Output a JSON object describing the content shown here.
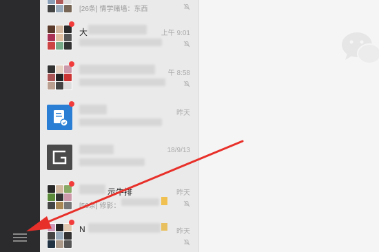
{
  "chats": [
    {
      "id": "row0",
      "name": "",
      "preview": "[26条] 情学赌墙：东西",
      "time": "",
      "unread": false,
      "avatar": "group",
      "muted": true
    },
    {
      "id": "row1",
      "name": "大",
      "preview": "",
      "time": "上午 9:01",
      "unread": true,
      "avatar": "group",
      "muted": true
    },
    {
      "id": "row2",
      "name": "",
      "preview": "",
      "time": "午 8:58",
      "unread": true,
      "avatar": "group",
      "muted": true
    },
    {
      "id": "row3",
      "name": "",
      "preview": "",
      "time": "昨天",
      "unread": true,
      "avatar": "doc",
      "muted": false
    },
    {
      "id": "row4",
      "name": "",
      "preview": "",
      "time": "18/9/13",
      "unread": false,
      "avatar": "g",
      "muted": false
    },
    {
      "id": "row5",
      "name": "示牛排",
      "preview": "[50条] 修影：",
      "time": "昨天",
      "unread": true,
      "avatar": "group",
      "muted": true
    },
    {
      "id": "row6",
      "name": "N",
      "preview": "",
      "time": "昨天",
      "unread": true,
      "avatar": "group",
      "muted": true
    }
  ],
  "colors": {
    "sidebar": "#2b2b2e",
    "list": "#eaeaea",
    "main": "#f5f5f5",
    "unread_dot": "#f23c3c",
    "arrow": "#e8302a",
    "doc_avatar": "#2a7fd4",
    "g_avatar": "#4a4a4a"
  },
  "icons": {
    "menu": "hamburger-menu-icon",
    "mute": "bell-mute-icon",
    "logo": "wechat-logo-icon"
  }
}
